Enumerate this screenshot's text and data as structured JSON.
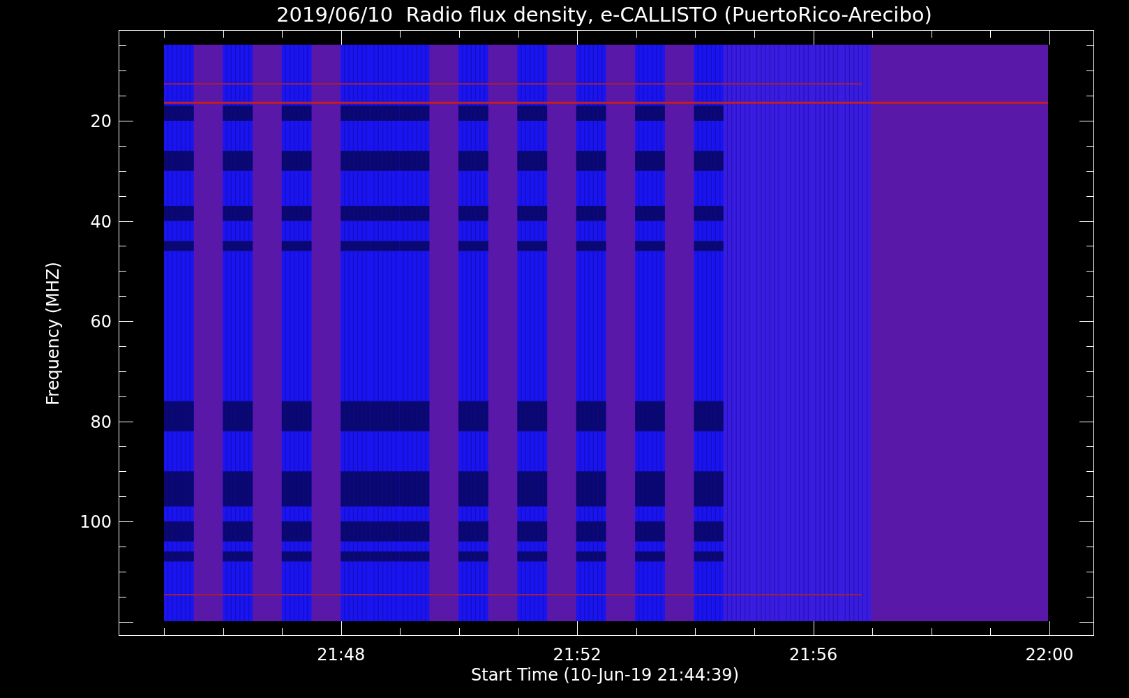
{
  "title": "2019/06/10  Radio flux density, e-CALLISTO (PuertoRico-Arecibo)",
  "y_axis": {
    "label": "Frequency (MHZ)",
    "ticks": [
      "20",
      "40",
      "60",
      "80",
      "100"
    ]
  },
  "x_axis": {
    "label": "Start Time (10-Jun-19 21:44:39)",
    "ticks": [
      "21:48",
      "21:52",
      "21:56",
      "22:00"
    ]
  }
}
